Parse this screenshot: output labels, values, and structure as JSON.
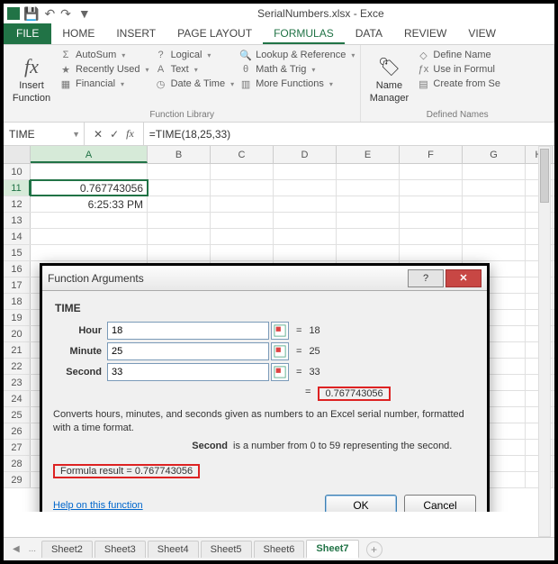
{
  "titlebar": {
    "filename": "SerialNumbers.xlsx - Exce"
  },
  "tabs": {
    "file": "FILE",
    "home": "HOME",
    "insert": "INSERT",
    "pagelayout": "PAGE LAYOUT",
    "formulas": "FORMULAS",
    "data": "DATA",
    "review": "REVIEW",
    "view": "VIEW"
  },
  "ribbon": {
    "insertfn_top": "Insert",
    "insertfn_bot": "Function",
    "autosum": "AutoSum",
    "recent": "Recently Used",
    "financial": "Financial",
    "logical": "Logical",
    "text": "Text",
    "datetime": "Date & Time",
    "lookup": "Lookup & Reference",
    "mathtrig": "Math & Trig",
    "morefn": "More Functions",
    "group1": "Function Library",
    "namemgr_top": "Name",
    "namemgr_bot": "Manager",
    "definename": "Define Name",
    "useinf": "Use in Formul",
    "createfrom": "Create from Se",
    "group2": "Defined Names"
  },
  "fbar": {
    "namebox": "TIME",
    "formula": "=TIME(18,25,33)"
  },
  "cells": {
    "a11": "0.767743056",
    "a12": "6:25:33 PM"
  },
  "rows": [
    "10",
    "11",
    "12",
    "13",
    "14",
    "15",
    "16",
    "17",
    "18",
    "19",
    "20",
    "21",
    "22",
    "23",
    "24",
    "25",
    "26",
    "27",
    "28",
    "29"
  ],
  "dialog": {
    "title": "Function Arguments",
    "fn": "TIME",
    "hour_lbl": "Hour",
    "hour_val": "18",
    "hour_res": "18",
    "minute_lbl": "Minute",
    "minute_val": "25",
    "minute_res": "25",
    "second_lbl": "Second",
    "second_val": "33",
    "second_res": "33",
    "eq": "=",
    "result": "0.767743056",
    "desc": "Converts hours, minutes, and seconds given as numbers to an Excel serial number, formatted with a time format.",
    "arg_name": "Second",
    "arg_desc": "is a number from 0 to 59 representing the second.",
    "formres_lbl": "Formula result =  ",
    "formres_val": "0.767743056",
    "help": "Help on this function",
    "ok": "OK",
    "cancel": "Cancel",
    "helpq": "?"
  },
  "sheets": {
    "dots": "...",
    "s2": "Sheet2",
    "s3": "Sheet3",
    "s4": "Sheet4",
    "s5": "Sheet5",
    "s6": "Sheet6",
    "s7": "Sheet7"
  }
}
